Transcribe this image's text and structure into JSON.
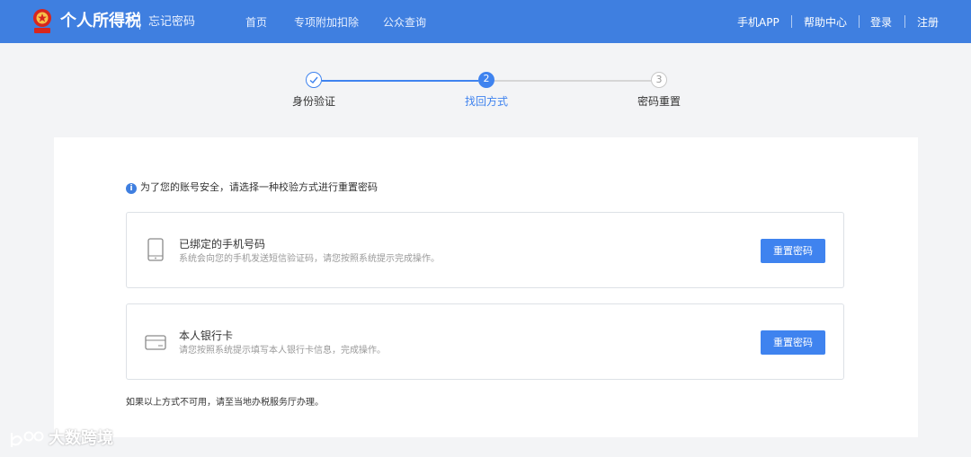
{
  "header": {
    "brand": "个人所得税",
    "subtitle": "忘记密码",
    "nav": [
      "首页",
      "专项附加扣除",
      "公众查询"
    ],
    "right": [
      "手机APP",
      "帮助中心",
      "登录",
      "注册"
    ]
  },
  "steps": [
    {
      "label": "身份验证",
      "number": "1",
      "status": "done"
    },
    {
      "label": "找回方式",
      "number": "2",
      "status": "active"
    },
    {
      "label": "密码重置",
      "number": "3",
      "status": "pending"
    }
  ],
  "notice": "为了您的账号安全，请选择一种校验方式进行重置密码",
  "options": [
    {
      "icon": "phone-icon",
      "title": "已绑定的手机号码",
      "desc": "系统会向您的手机发送短信验证码，请您按照系统提示完成操作。",
      "button": "重置密码"
    },
    {
      "icon": "bank-card-icon",
      "title": "本人银行卡",
      "desc": "请您按照系统提示填写本人银行卡信息，完成操作。",
      "button": "重置密码"
    }
  ],
  "footnote": "如果以上方式不可用，请至当地办税服务厅办理。",
  "watermark": "大数跨境",
  "colors": {
    "header": "#3f7fe0",
    "primary": "#3f83ef",
    "background": "#f3f4f6",
    "step_inactive": "#cccccc"
  }
}
